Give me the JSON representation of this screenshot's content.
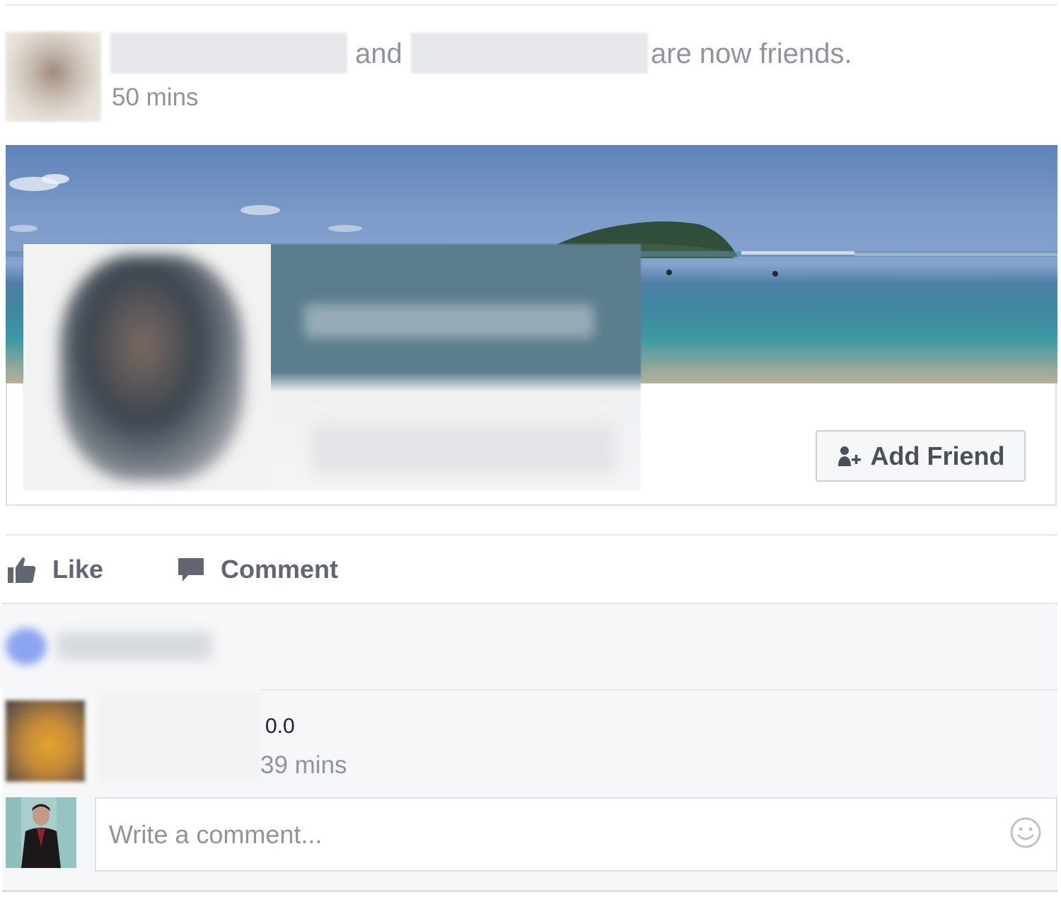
{
  "story": {
    "connector_word": "and",
    "headline_suffix": "are now friends.",
    "timestamp": "50 mins"
  },
  "attachment": {
    "add_friend_label": "Add Friend"
  },
  "actions": {
    "like_label": "Like",
    "comment_label": "Comment"
  },
  "comment": {
    "text": "0.0",
    "timestamp": "39 mins"
  },
  "composer": {
    "placeholder": "Write a comment..."
  },
  "icons": {
    "add_friend": "add-friend-icon",
    "like": "thumbs-up-icon",
    "comment": "speech-bubble-icon",
    "emoji": "smiley-icon"
  },
  "colors": {
    "meta_text": "#90949c",
    "action_text": "#616770",
    "button_text": "#4b4f56",
    "comments_bg": "#f6f7f9",
    "border": "#dddfe2"
  }
}
